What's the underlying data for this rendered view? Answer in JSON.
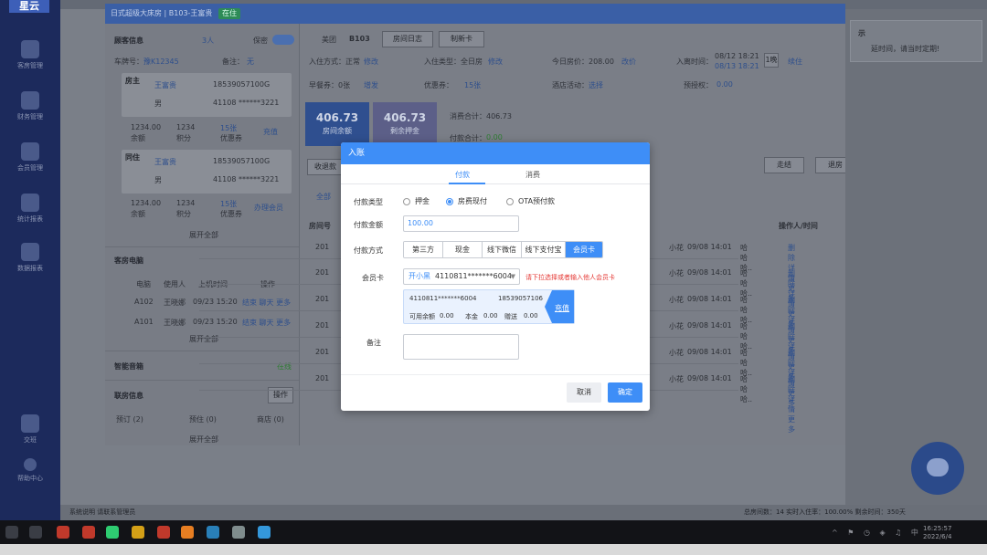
{
  "app": {
    "logo": "星云",
    "nav": [
      "客房管理",
      "财务管理",
      "会员管理",
      "统计报表",
      "数据报表",
      "交班",
      "帮助中心"
    ],
    "right_card_title": "示",
    "right_card_text": "延时间，请当时定期!",
    "bottom_left": "系统说明 请联系管理员",
    "bottom_right": "总房间数：14   实时入住率：100.00%   剩余时间：350天"
  },
  "room": {
    "title": "日式超级大床房 | B103-王富贵",
    "status": "在住",
    "guest_info_label": "顾客信息",
    "guest_count": "3人",
    "secret_label": "保密",
    "plate_label": "车牌号：",
    "plate_value": "豫K12345",
    "remark_label": "备注：",
    "remark_value": "无",
    "host_tag": "房主",
    "host_name": "王富贵",
    "host_phone": "18539057100G",
    "host_gender": "男",
    "host_id": "41108 ******3221",
    "host_amount": "1234.00",
    "host_points": "1234",
    "host_coupon": "15张",
    "host_amount_label": "余额",
    "host_points_label": "积分",
    "host_coupon_label": "优惠券",
    "recharge": "充值",
    "cohabit_tag": "同住",
    "cohabit_name": "王富贵",
    "cohabit_phone": "18539057100G",
    "cohabit_gender": "男",
    "cohabit_id": "41108 ******3221",
    "cohabit_amount": "1234.00",
    "cohabit_points": "1234",
    "cohabit_coupon": "15张",
    "handle_member": "办理会员",
    "expand_all": "展开全部",
    "pc_title": "客房电脑",
    "pc_headers": [
      "电脑",
      "使用人",
      "上机时间",
      "操作"
    ],
    "pc_rows": [
      {
        "pc": "A102",
        "user": "王晓娜",
        "time": "09/23 15:20",
        "ops": "结束 聊天 更多"
      },
      {
        "pc": "A101",
        "user": "王晓娜",
        "time": "09/23 15:20",
        "ops": "结束 聊天 更多"
      }
    ],
    "speaker_title": "智能音箱",
    "speaker_status": "在线",
    "linked_title": "联房信息",
    "op_label": "操作",
    "linked_items": [
      "预订 (2)",
      "预住 (0)",
      "商店 (0)"
    ],
    "channel": "美团",
    "room_no": "B103",
    "room_log": "房间日志",
    "make_card": "制新卡",
    "checkin_way": "入住方式：正常",
    "modify": "修改",
    "checkin_type": "入住类型：全日房",
    "today_price": "今日房价：208.00",
    "adjust": "改价",
    "checkin_time_label": "入离时间：",
    "checkin_time": "08/12  18:21",
    "checkout_time": "08/13  18:21",
    "night_count": "1晚",
    "extend": "续住",
    "breakfast": "早餐券：0张",
    "grant": "增发",
    "coupon": "优惠券：",
    "coupon_value": "15张",
    "hotel_activity": "酒店活动：",
    "select": "选择",
    "preauth": "预授权：",
    "preauth_value": "0.00",
    "balance_value": "406.73",
    "balance_label": "房间余额",
    "deposit_value": "406.73",
    "deposit_label": "剩余押金",
    "consume_total": "消费合计：406.73",
    "pay_total": "付款合计：",
    "pay_total_value": "0.00",
    "collect": "收退款",
    "checkout": "走结",
    "checkout2": "退房",
    "all_tab": "全部",
    "print": "打印",
    "export": "导出",
    "table_headers": [
      "房间号",
      "操作人/时间",
      "备注",
      "操作"
    ],
    "rows": [
      {
        "room": "201",
        "op": "小花",
        "time": "09/08 14:01",
        "remark": "哈哈哈..",
        "actions": "删除 详情 更多"
      },
      {
        "room": "201",
        "op": "小花",
        "time": "09/08 14:01",
        "remark": "哈哈哈..",
        "actions": "删除 详情 更多"
      },
      {
        "room": "201",
        "op": "小花",
        "time": "09/08 14:01",
        "remark": "哈哈哈..",
        "actions": "删除 详情 更多"
      },
      {
        "room": "201",
        "op": "小花",
        "time": "09/08 14:01",
        "remark": "哈哈哈..",
        "actions": "删除 详情 更多"
      },
      {
        "room": "201",
        "op": "小花",
        "time": "09/08 14:01",
        "remark": "哈哈哈..",
        "actions": "删除 详情 更多"
      },
      {
        "room": "201",
        "op": "小花",
        "time": "09/08 14:01",
        "remark": "哈哈哈..",
        "actions": "删除 详情 更多"
      }
    ]
  },
  "modal": {
    "title": "入账",
    "tabs": [
      "付款",
      "消费"
    ],
    "pay_type_label": "付款类型",
    "pay_types": [
      "押金",
      "房费现付",
      "OTA预付款"
    ],
    "amount_label": "付款金额",
    "amount_value": "100.00",
    "method_label": "付款方式",
    "methods": [
      "第三方",
      "现金",
      "线下微信",
      "线下支付宝",
      "会员卡"
    ],
    "card_label": "会员卡",
    "card_name": "开小黑",
    "card_no": "4110811*******6004",
    "card_hint": "请下拉选择或者输入他人会员卡",
    "mc_no": "4110811*******6004",
    "mc_phone": "18539057106",
    "mc_available_label": "可用余额",
    "mc_available": "0.00",
    "mc_principal_label": "本金",
    "mc_principal": "0.00",
    "mc_gift_label": "赠送",
    "mc_gift": "0.00",
    "mc_recharge": "充值",
    "remark_label": "备注",
    "cancel": "取消",
    "confirm": "确定"
  },
  "taskbar": {
    "time": "16:25:57",
    "date": "2022/6/4",
    "lang": "中"
  }
}
